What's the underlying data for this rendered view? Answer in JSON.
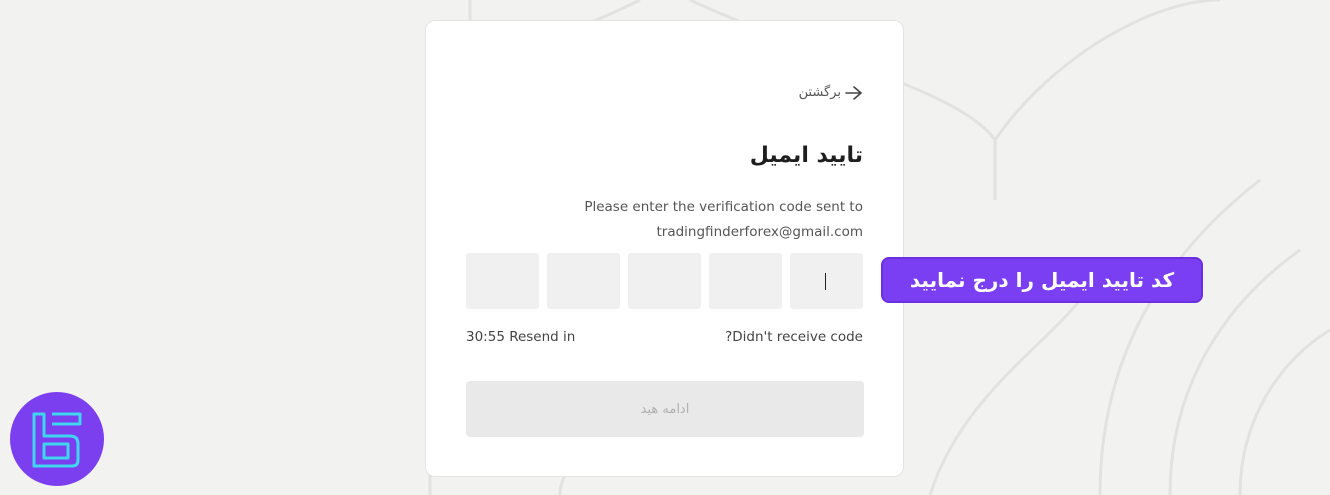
{
  "back": {
    "label": "برگشتن"
  },
  "page": {
    "title": "تایید ایمیل",
    "description_line1": "Please enter the verification code sent to",
    "description_line2": "tradingfinderforex@gmail.com"
  },
  "otp": {
    "digits": [
      "",
      "",
      "",
      "",
      ""
    ]
  },
  "timer": {
    "resend_text": "30:55 Resend in"
  },
  "links": {
    "no_code": "?Didn't receive code"
  },
  "button": {
    "continue_label": "ادامه هید"
  },
  "annotation": {
    "text": "کد تایید ایمیل را درج نمایید"
  },
  "colors": {
    "accent": "#7a3ff2",
    "logo_bg": "#7c3ff0",
    "logo_stroke": "#3fd6f0"
  }
}
